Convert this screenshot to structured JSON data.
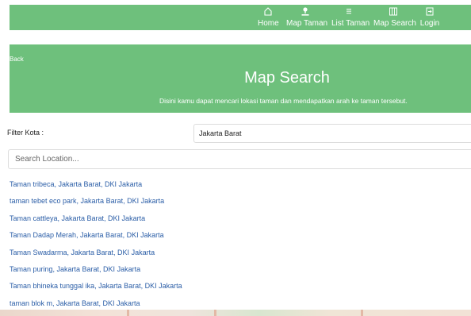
{
  "nav": {
    "items": [
      {
        "label": "Home",
        "icon": "home-icon"
      },
      {
        "label": "Map Taman",
        "icon": "map-pin-icon"
      },
      {
        "label": "List Taman",
        "icon": "list-icon"
      },
      {
        "label": "Map Search",
        "icon": "map-icon"
      },
      {
        "label": "Login",
        "icon": "login-icon"
      }
    ]
  },
  "hero": {
    "back_label": "Back",
    "title": "Map Search",
    "subtitle": "Disini kamu dapat mencari lokasi taman dan mendapatkan arah ke taman tersebut."
  },
  "filter": {
    "label": "Filter Kota :",
    "selected": "Jakarta Barat"
  },
  "search": {
    "placeholder": "Search Location...",
    "value": ""
  },
  "results": [
    "Taman tribeca, Jakarta Barat, DKI Jakarta",
    "taman tebet eco park, Jakarta Barat, DKI Jakarta",
    "Taman cattleya, Jakarta Barat, DKI Jakarta",
    "Taman Dadap Merah, Jakarta Barat, DKI Jakarta",
    "Taman Swadarma, Jakarta Barat, DKI Jakarta",
    "Taman puring, Jakarta Barat, DKI Jakarta",
    "Taman bhineka tunggal ika, Jakarta Barat, DKI Jakarta",
    "taman blok m, Jakarta Barat, DKI Jakarta"
  ],
  "colors": {
    "brand_green": "#6ec07c",
    "link_blue": "#2b5ea7"
  }
}
